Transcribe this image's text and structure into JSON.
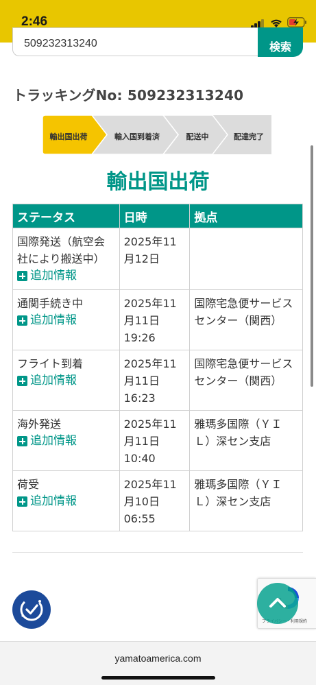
{
  "status_bar": {
    "time": "2:46"
  },
  "search": {
    "value": "509232313240",
    "button_label": "検索"
  },
  "tracking": {
    "title": "トラッキングNo: 509232313240"
  },
  "progress": {
    "current_index": 0,
    "steps": [
      "輸出国出荷",
      "輸入国到着済",
      "配送中",
      "配達完了"
    ],
    "colors": {
      "active": "#f5c400",
      "inactive": "#dcdcdc"
    }
  },
  "section_heading": "輸出国出荷",
  "table": {
    "headers": [
      "ステータス",
      "日時",
      "拠点"
    ],
    "more_label": "追加情報",
    "rows": [
      {
        "status": "国際発送（航空会社により搬送中）",
        "datetime": "2025年11月12日",
        "location": ""
      },
      {
        "status": "通関手続き中",
        "datetime": "2025年11月11日 19:26",
        "location": "国際宅急便サービスセンター（関西）"
      },
      {
        "status": "フライト到着",
        "datetime": "2025年11月11日 16:23",
        "location": "国際宅急便サービスセンター（関西）"
      },
      {
        "status": "海外発送",
        "datetime": "2025年11月11日 10:40",
        "location": "雅瑪多国際（ＹＩＬ）深セン支店"
      },
      {
        "status": "荷受",
        "datetime": "2025年11月10日 06:55",
        "location": "雅瑪多国際（ＹＩＬ）深セン支店"
      }
    ]
  },
  "recaptcha": {
    "text": "プライバシー・利用規約"
  },
  "browser": {
    "url": "yamatoamerica.com"
  },
  "theme": {
    "accent": "#009688",
    "status_bar": "#e8c600"
  },
  "icons": [
    "signal-icon",
    "wifi-icon",
    "battery-charging-icon",
    "accessibility-icon",
    "recaptcha-icon",
    "chevron-up-icon",
    "plus-square-icon"
  ]
}
